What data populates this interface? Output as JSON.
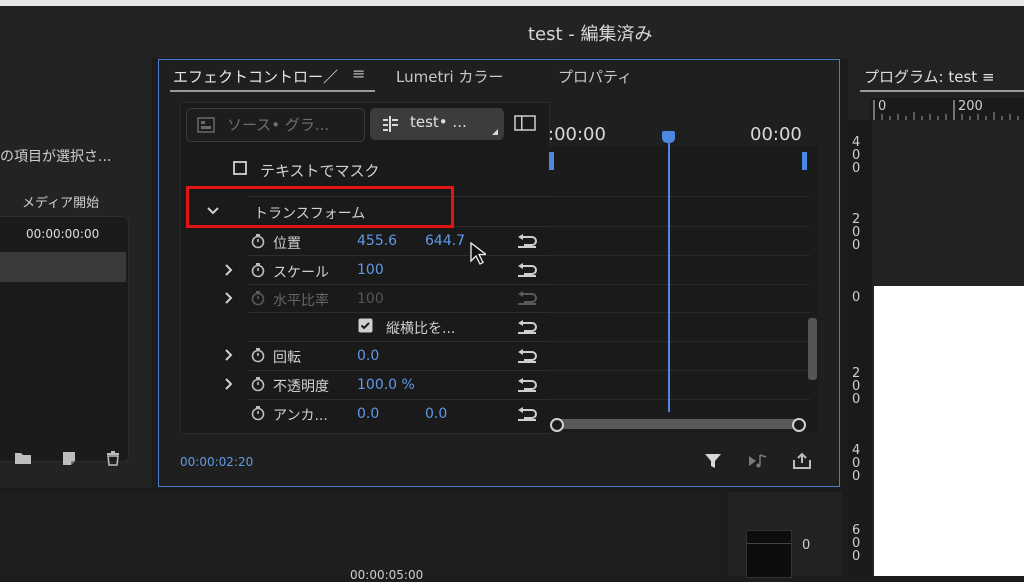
{
  "window": {
    "title": "test - 編集済み"
  },
  "left_panel": {
    "selection_text": "の項目が選択さ...",
    "media_start_label": "メディア開始",
    "media_start_value": "00:00:00:00",
    "icons": [
      "folder-icon",
      "new-item-icon",
      "trash-icon"
    ]
  },
  "effect_panel": {
    "tabs": [
      {
        "label": "エフェクトコントロー／",
        "active": true
      },
      {
        "label": "Lumetri カラー",
        "active": false
      },
      {
        "label": "プロパティ",
        "active": false
      }
    ],
    "menu_glyph": "≡",
    "source_button": "ソース• グラ...",
    "clip_button": "test• ...",
    "mask_label": "テキストでマスク",
    "section_title": "トランスフォーム",
    "properties": [
      {
        "label": "位置",
        "value1": "455.6",
        "value2": "644.7",
        "expand": false,
        "dim": false
      },
      {
        "label": "スケール",
        "value1": "100",
        "value2": "",
        "expand": true,
        "dim": false
      },
      {
        "label": "水平比率",
        "value1": "100",
        "value2": "",
        "expand": true,
        "dim": true
      },
      {
        "label": "縦横比を...",
        "value1": "",
        "value2": "",
        "expand": false,
        "dim": false,
        "checkbox": true
      },
      {
        "label": "回転",
        "value1": "0.0",
        "value2": "",
        "expand": true,
        "dim": false
      },
      {
        "label": "不透明度",
        "value1": "100.0 %",
        "value2": "",
        "expand": true,
        "dim": false
      },
      {
        "label": "アンカ...",
        "value1": "0.0",
        "value2": "0.0",
        "expand": false,
        "dim": false
      }
    ],
    "timeline_start": ":00:00",
    "timeline_end": "00:00",
    "current_time": "00:00:02:20"
  },
  "program_monitor": {
    "title": "プログラム: test",
    "menu_glyph": "≡",
    "ruler_top": [
      "0",
      "200"
    ],
    "ruler_left": [
      "4\n0\n0",
      "2\n0\n0",
      "0",
      "2\n0\n0",
      "4\n0\n0",
      "6\n0\n0"
    ]
  },
  "bottom": {
    "timecode_partial": "00:00:05:00",
    "meter_zero": "0"
  },
  "colors": {
    "accent": "#4d88e0",
    "highlight": "#e21414",
    "value_blue": "#5e9ae6"
  }
}
